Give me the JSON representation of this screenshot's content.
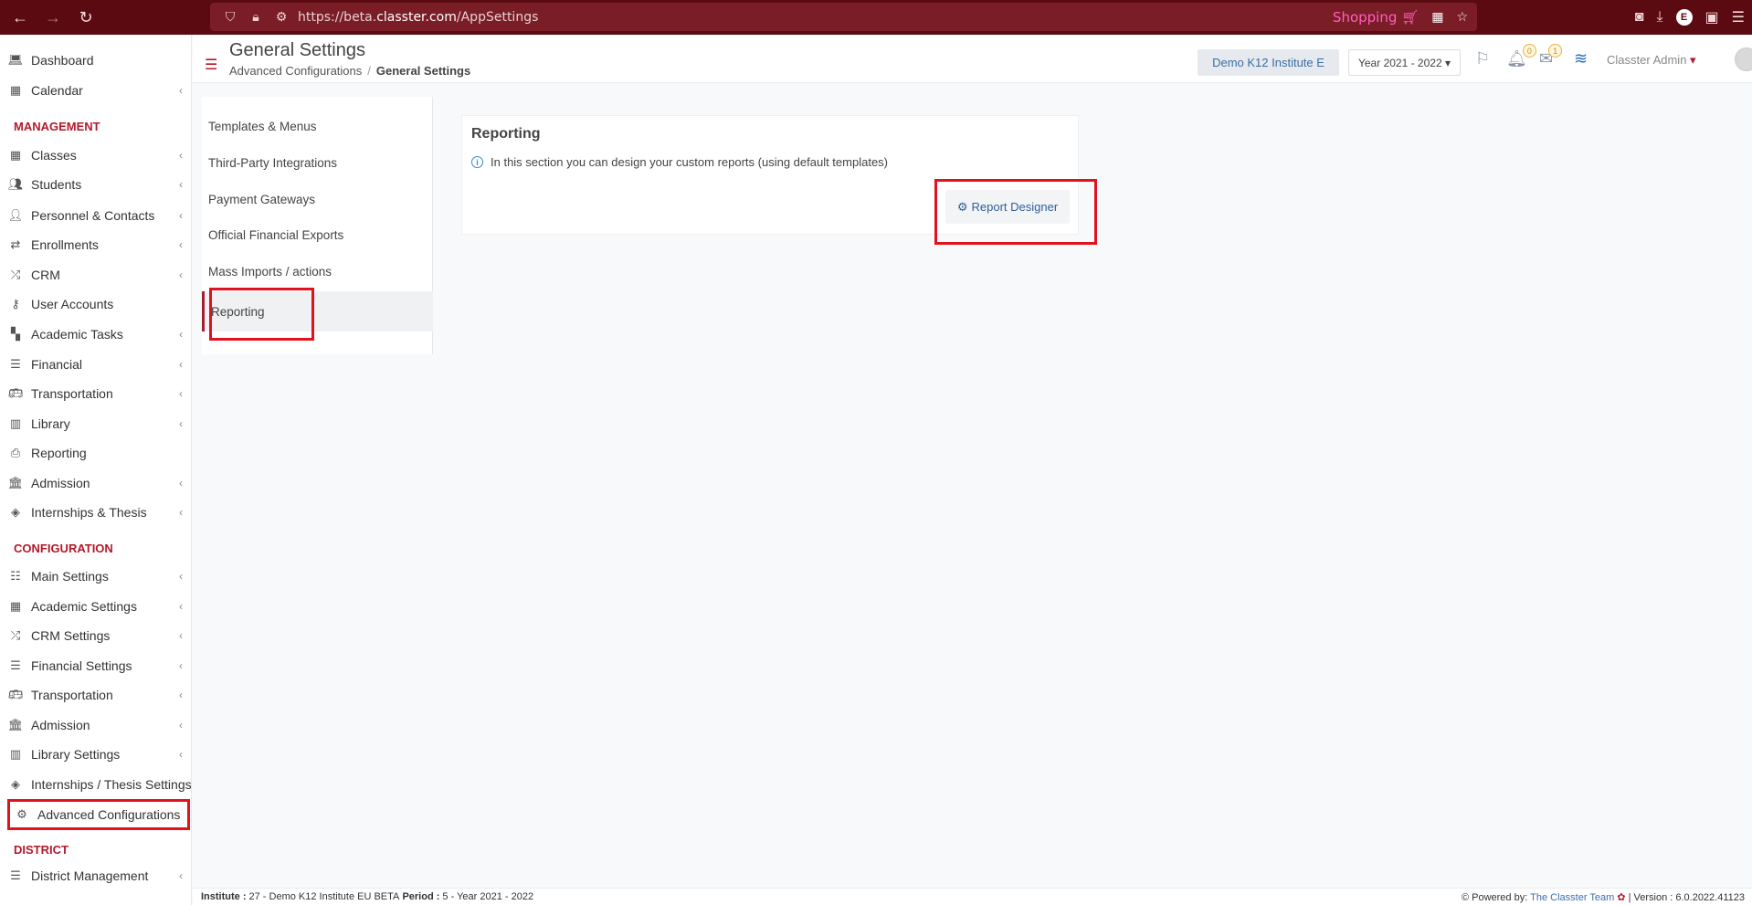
{
  "browser": {
    "url_prefix": "https://beta.",
    "url_host": "classter.com",
    "url_path": "/AppSettings",
    "shopping_label": "Shopping",
    "profile_letter": "E"
  },
  "sidebar": {
    "items_top": [
      {
        "label": "Dashboard",
        "icon": "laptop-icon",
        "chev": false
      },
      {
        "label": "Calendar",
        "icon": "calendar-icon",
        "chev": true
      }
    ],
    "section_management": "MANAGEMENT",
    "items_management": [
      {
        "label": "Classes",
        "icon": "classes-icon",
        "chev": true
      },
      {
        "label": "Students",
        "icon": "students-icon",
        "chev": true
      },
      {
        "label": "Personnel & Contacts",
        "icon": "person-icon",
        "chev": true
      },
      {
        "label": "Enrollments",
        "icon": "exchange-icon",
        "chev": true
      },
      {
        "label": "CRM",
        "icon": "shuffle-icon",
        "chev": true
      },
      {
        "label": "User Accounts",
        "icon": "key-icon",
        "chev": false
      },
      {
        "label": "Academic Tasks",
        "icon": "grid-icon",
        "chev": true
      },
      {
        "label": "Financial",
        "icon": "coins-icon",
        "chev": true
      },
      {
        "label": "Transportation",
        "icon": "bus-icon",
        "chev": true
      },
      {
        "label": "Library",
        "icon": "books-icon",
        "chev": true
      },
      {
        "label": "Reporting",
        "icon": "printer-icon",
        "chev": false
      },
      {
        "label": "Admission",
        "icon": "institution-icon",
        "chev": true
      },
      {
        "label": "Internships & Thesis",
        "icon": "cube-icon",
        "chev": true
      }
    ],
    "section_configuration": "CONFIGURATION",
    "items_configuration": [
      {
        "label": "Main Settings",
        "icon": "sliders-icon",
        "chev": true
      },
      {
        "label": "Academic Settings",
        "icon": "classes-icon",
        "chev": true
      },
      {
        "label": "CRM Settings",
        "icon": "shuffle-icon",
        "chev": true
      },
      {
        "label": "Financial Settings",
        "icon": "coins-icon",
        "chev": true
      },
      {
        "label": "Transportation",
        "icon": "bus-icon",
        "chev": true
      },
      {
        "label": "Admission",
        "icon": "institution-icon",
        "chev": true
      },
      {
        "label": "Library Settings",
        "icon": "books-icon",
        "chev": true
      },
      {
        "label": "Internships / Thesis Settings",
        "icon": "cube-icon",
        "chev": false
      },
      {
        "label": "Advanced Configurations",
        "icon": "gears-icon",
        "chev": false
      }
    ],
    "section_district": "DISTRICT",
    "items_district": [
      {
        "label": "District Management",
        "icon": "list-icon",
        "chev": true
      }
    ]
  },
  "header": {
    "title": "General Settings",
    "breadcrumb_parent": "Advanced Configurations",
    "breadcrumb_current": "General Settings",
    "institute": "Demo K12 Institute E",
    "year": "Year 2021 - 2022",
    "notifications_count": "0",
    "messages_count": "1",
    "user": "Classter Admin"
  },
  "settings_nav": [
    "Templates & Menus",
    "Third-Party Integrations",
    "Payment Gateways",
    "Official Financial Exports",
    "Mass Imports / actions",
    "Reporting"
  ],
  "card": {
    "title": "Reporting",
    "info": "In this section you can design your custom reports (using default templates)",
    "button": "Report Designer"
  },
  "footer": {
    "institute_label": "Institute :",
    "institute_value": "27 - Demo K12 Institute EU BETA",
    "period_label": "Period :",
    "period_value": "5 - Year 2021 - 2022",
    "powered_label": "Powered by:",
    "powered_link": "The Classter Team",
    "version": "| Version : 6.0.2022.41123"
  },
  "colors": {
    "brand": "#b3192b",
    "highlight": "#e3101d",
    "browser": "#5b0a11"
  }
}
